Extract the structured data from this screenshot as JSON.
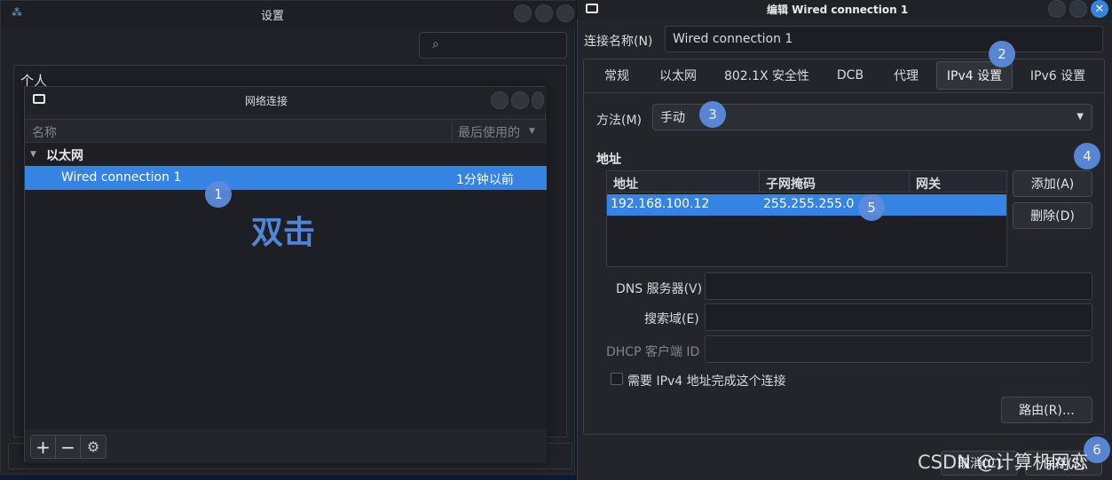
{
  "settings": {
    "title": "设置",
    "section_header": "个人"
  },
  "network": {
    "title": "网络连接",
    "columns": [
      "名称",
      "最后使用的"
    ],
    "group": "以太网",
    "connection": {
      "name": "Wired connection 1",
      "last_used": "1分钟以前"
    },
    "annotation": "双击"
  },
  "editor": {
    "title": "编辑 Wired connection 1",
    "conn_name_label": "连接名称(N)",
    "conn_name_value": "Wired connection 1",
    "tabs": [
      "常规",
      "以太网",
      "802.1X 安全性",
      "DCB",
      "代理",
      "IPv4 设置",
      "IPv6 设置"
    ],
    "active_tab": "IPv4 设置",
    "method_label": "方法(M)",
    "method_value": "手动",
    "address_heading": "地址",
    "table": {
      "headers": [
        "地址",
        "子网掩码",
        "网关"
      ],
      "rows": [
        [
          "192.168.100.12",
          "255.255.255.0",
          ""
        ]
      ]
    },
    "add_button": "添加(A)",
    "delete_button": "删除(D)",
    "dns_label": "DNS 服务器(V)",
    "search_label": "搜索域(E)",
    "dhcp_label": "DHCP 客户端 ID",
    "checkbox_label": "需要 IPv4 地址完成这个连接",
    "routes_button": "路由(R)…",
    "cancel_button": "取消(C)",
    "save_button": "保存(S)"
  },
  "badges": [
    "1",
    "2",
    "3",
    "4",
    "5",
    "6"
  ],
  "watermark": "CSDN @计算机网恋",
  "colors": {
    "accent": "#3584e4",
    "badge": "#5b8bdc",
    "window": "#23252b"
  }
}
